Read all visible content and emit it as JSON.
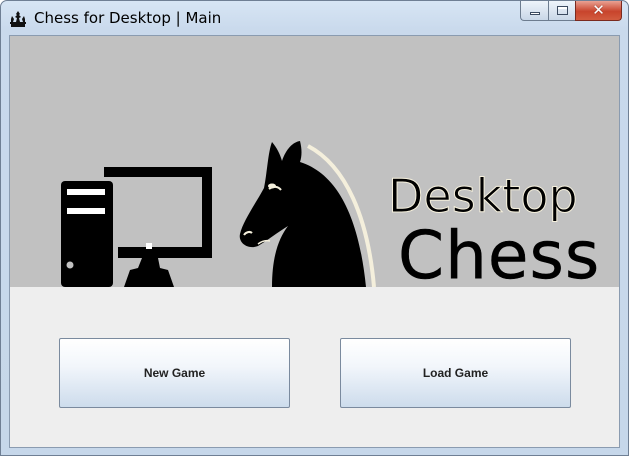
{
  "window": {
    "title": "Chess for Desktop | Main",
    "icon": "chess-pieces-icon",
    "controls": {
      "minimize": "minimize-icon",
      "maximize": "maximize-icon",
      "close_glyph": "✕"
    }
  },
  "banner": {
    "logo": {
      "line1": "Desktop",
      "line2": "Chess"
    },
    "background_color": "#c1c1c1"
  },
  "actions": {
    "new_game": "New Game",
    "load_game": "Load Game"
  }
}
